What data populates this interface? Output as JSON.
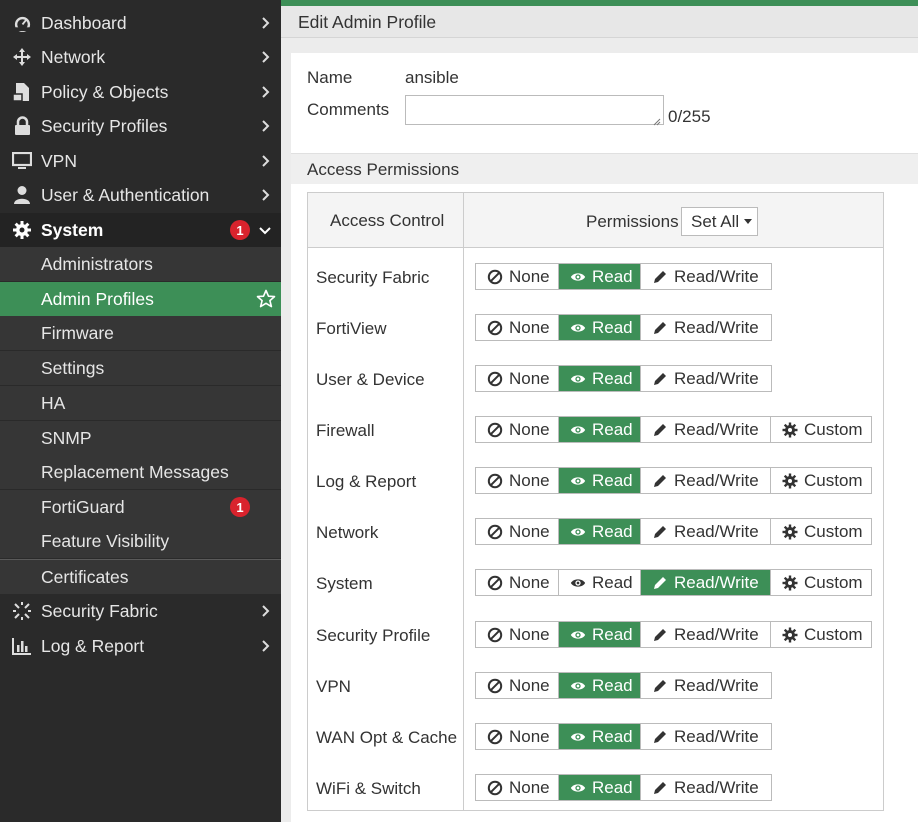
{
  "sidebar": {
    "items": [
      {
        "label": "Dashboard",
        "icon": "dashboard-icon"
      },
      {
        "label": "Network",
        "icon": "network-icon"
      },
      {
        "label": "Policy & Objects",
        "icon": "policy-icon"
      },
      {
        "label": "Security Profiles",
        "icon": "lock-icon"
      },
      {
        "label": "VPN",
        "icon": "monitor-icon"
      },
      {
        "label": "User & Authentication",
        "icon": "user-icon"
      },
      {
        "label": "System",
        "icon": "gear-icon",
        "badge": "1"
      }
    ],
    "system_sub": [
      {
        "label": "Administrators"
      },
      {
        "label": "Admin Profiles"
      },
      {
        "label": "Firmware"
      },
      {
        "label": "Settings"
      },
      {
        "label": "HA"
      },
      {
        "label": "SNMP"
      },
      {
        "label": "Replacement Messages"
      },
      {
        "label": "FortiGuard",
        "badge": "1"
      },
      {
        "label": "Feature Visibility"
      },
      {
        "label": "Certificates"
      }
    ],
    "bottom_items": [
      {
        "label": "Security Fabric",
        "icon": "security-fabric-icon"
      },
      {
        "label": "Log & Report",
        "icon": "log-report-icon"
      }
    ]
  },
  "page": {
    "title": "Edit Admin Profile"
  },
  "form": {
    "name_label": "Name",
    "name_value": "ansible",
    "comments_label": "Comments",
    "comments_value": "",
    "comments_count": "0/255"
  },
  "permissions": {
    "section_title": "Access Permissions",
    "col_access_control": "Access Control",
    "col_permissions": "Permissions",
    "set_all_label": "Set All",
    "option_labels": {
      "none": "None",
      "read": "Read",
      "rw": "Read/Write",
      "custom": "Custom"
    },
    "rows": [
      {
        "label": "Security Fabric",
        "selected": "read",
        "has_custom": false
      },
      {
        "label": "FortiView",
        "selected": "read",
        "has_custom": false
      },
      {
        "label": "User & Device",
        "selected": "read",
        "has_custom": false
      },
      {
        "label": "Firewall",
        "selected": "read",
        "has_custom": true
      },
      {
        "label": "Log & Report",
        "selected": "read",
        "has_custom": true
      },
      {
        "label": "Network",
        "selected": "read",
        "has_custom": true
      },
      {
        "label": "System",
        "selected": "rw",
        "has_custom": true
      },
      {
        "label": "Security Profile",
        "selected": "read",
        "has_custom": true
      },
      {
        "label": "VPN",
        "selected": "read",
        "has_custom": false
      },
      {
        "label": "WAN Opt & Cache",
        "selected": "read",
        "has_custom": false
      },
      {
        "label": "WiFi & Switch",
        "selected": "read",
        "has_custom": false
      }
    ]
  },
  "colors": {
    "accent": "#3d8f57",
    "sidebar_bg": "#2a2a2a",
    "badge": "#d9232d"
  }
}
